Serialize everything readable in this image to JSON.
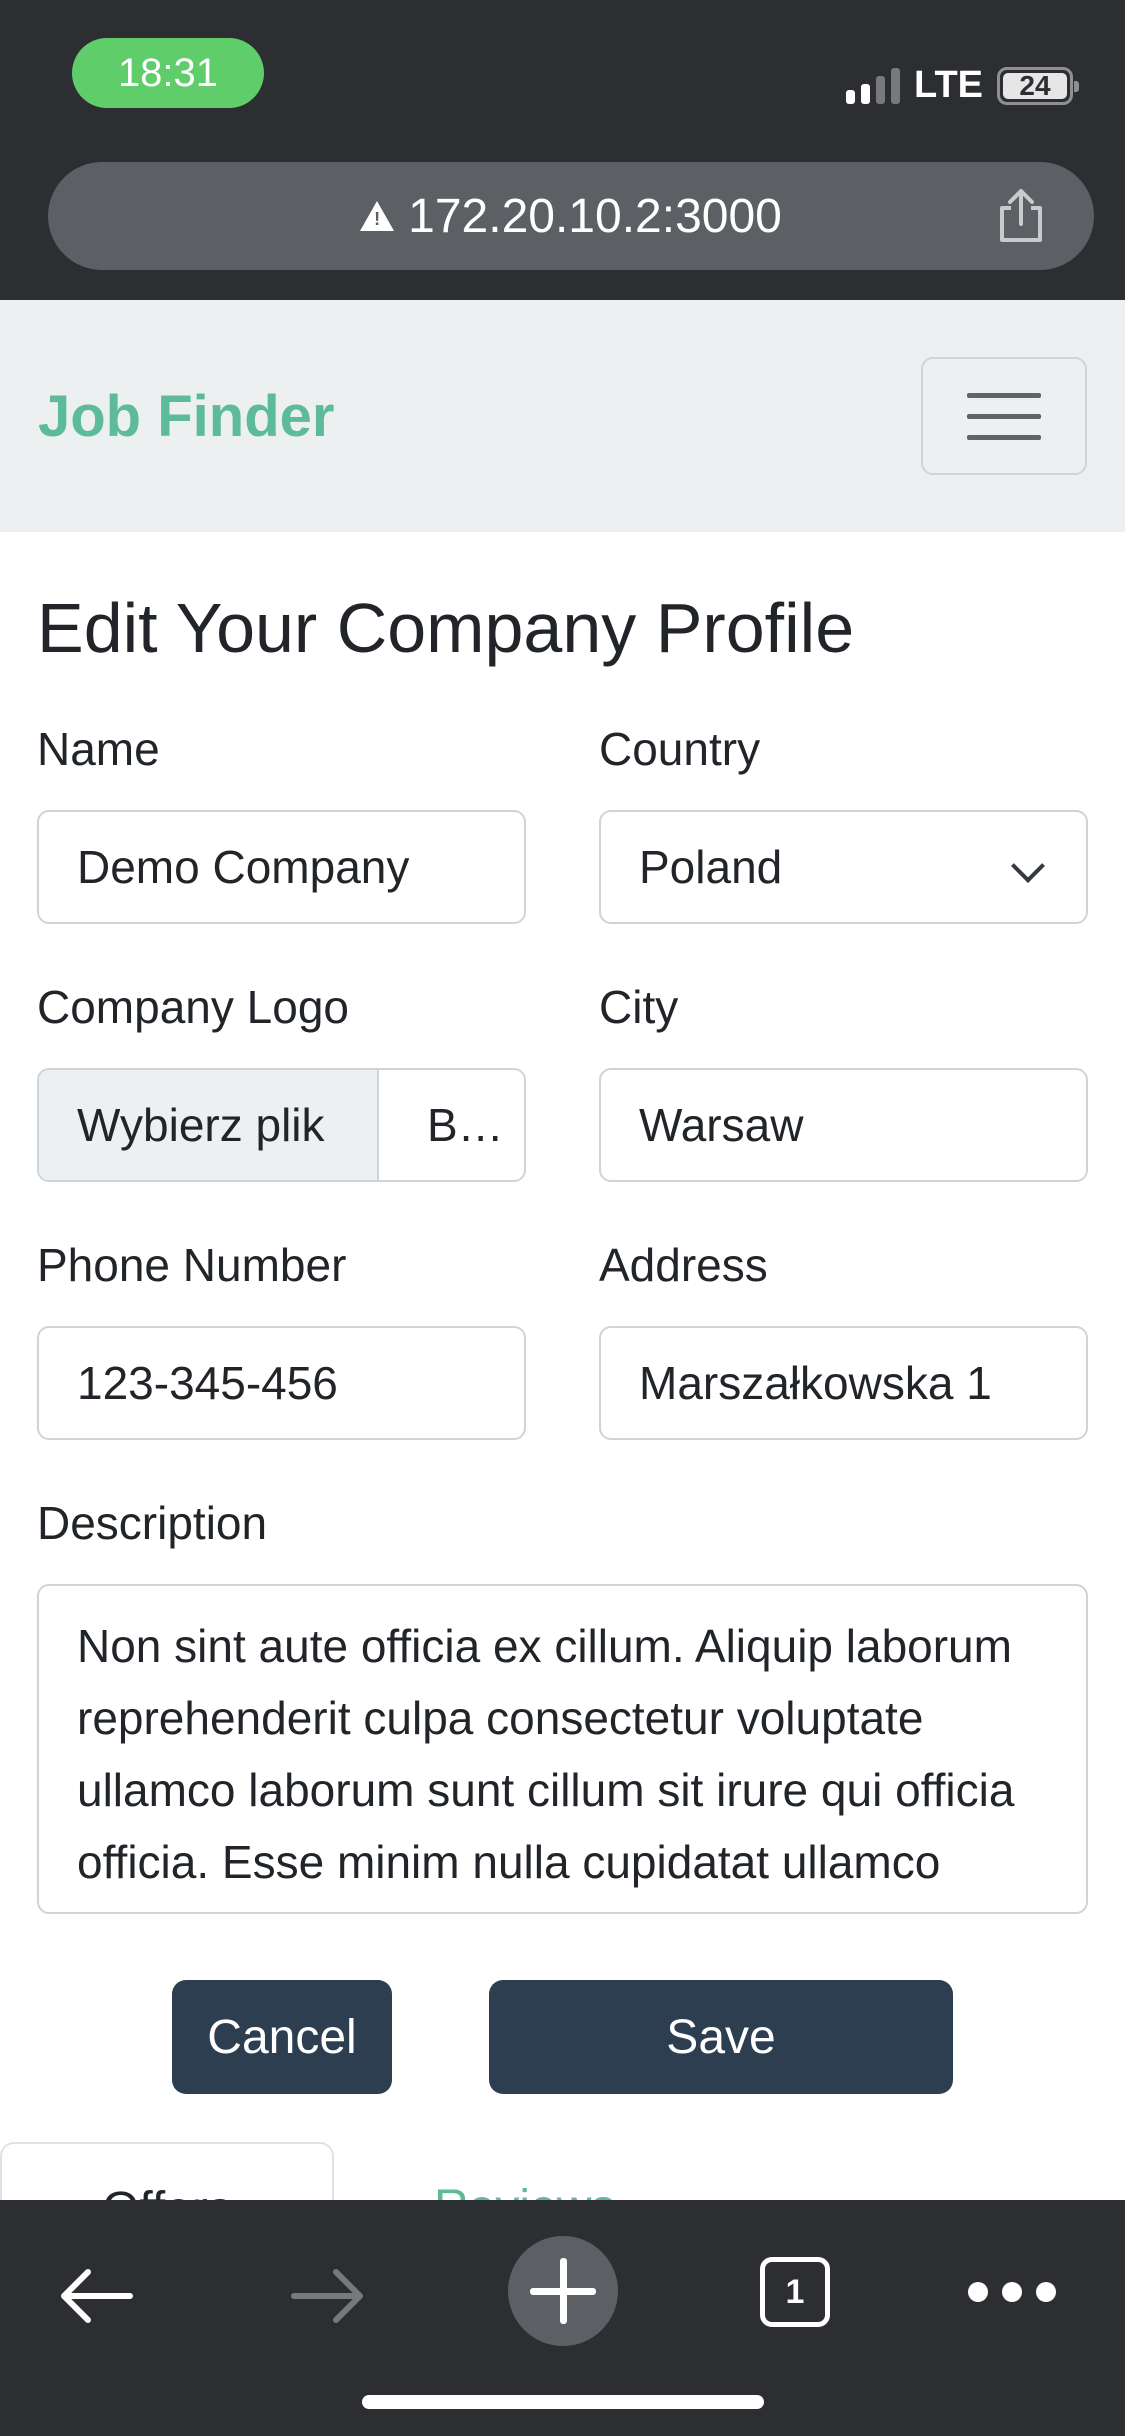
{
  "status_bar": {
    "time": "18:31",
    "network": "LTE",
    "battery": "24"
  },
  "browser": {
    "url": "172.20.10.2:3000",
    "open_tabs": "1"
  },
  "navbar": {
    "brand": "Job Finder"
  },
  "page": {
    "title": "Edit Your Company Profile"
  },
  "form": {
    "name_label": "Name",
    "name_value": "Demo Company",
    "country_label": "Country",
    "country_value": "Poland",
    "logo_label": "Company Logo",
    "logo_button": "Wybierz plik",
    "logo_filename": "B…",
    "city_label": "City",
    "city_value": "Warsaw",
    "phone_label": "Phone Number",
    "phone_value": "123-345-456",
    "address_label": "Address",
    "address_value": "Marszałkowska 1",
    "description_label": "Description",
    "description_value": "Non sint aute officia ex cillum. Aliquip laborum reprehenderit culpa consectetur voluptate ullamco laborum sunt cillum sit irure qui officia officia. Esse minim nulla cupidatat ullamco",
    "cancel_label": "Cancel",
    "save_label": "Save"
  },
  "tabs": [
    {
      "label": "Offers"
    },
    {
      "label": "Reviews"
    }
  ]
}
